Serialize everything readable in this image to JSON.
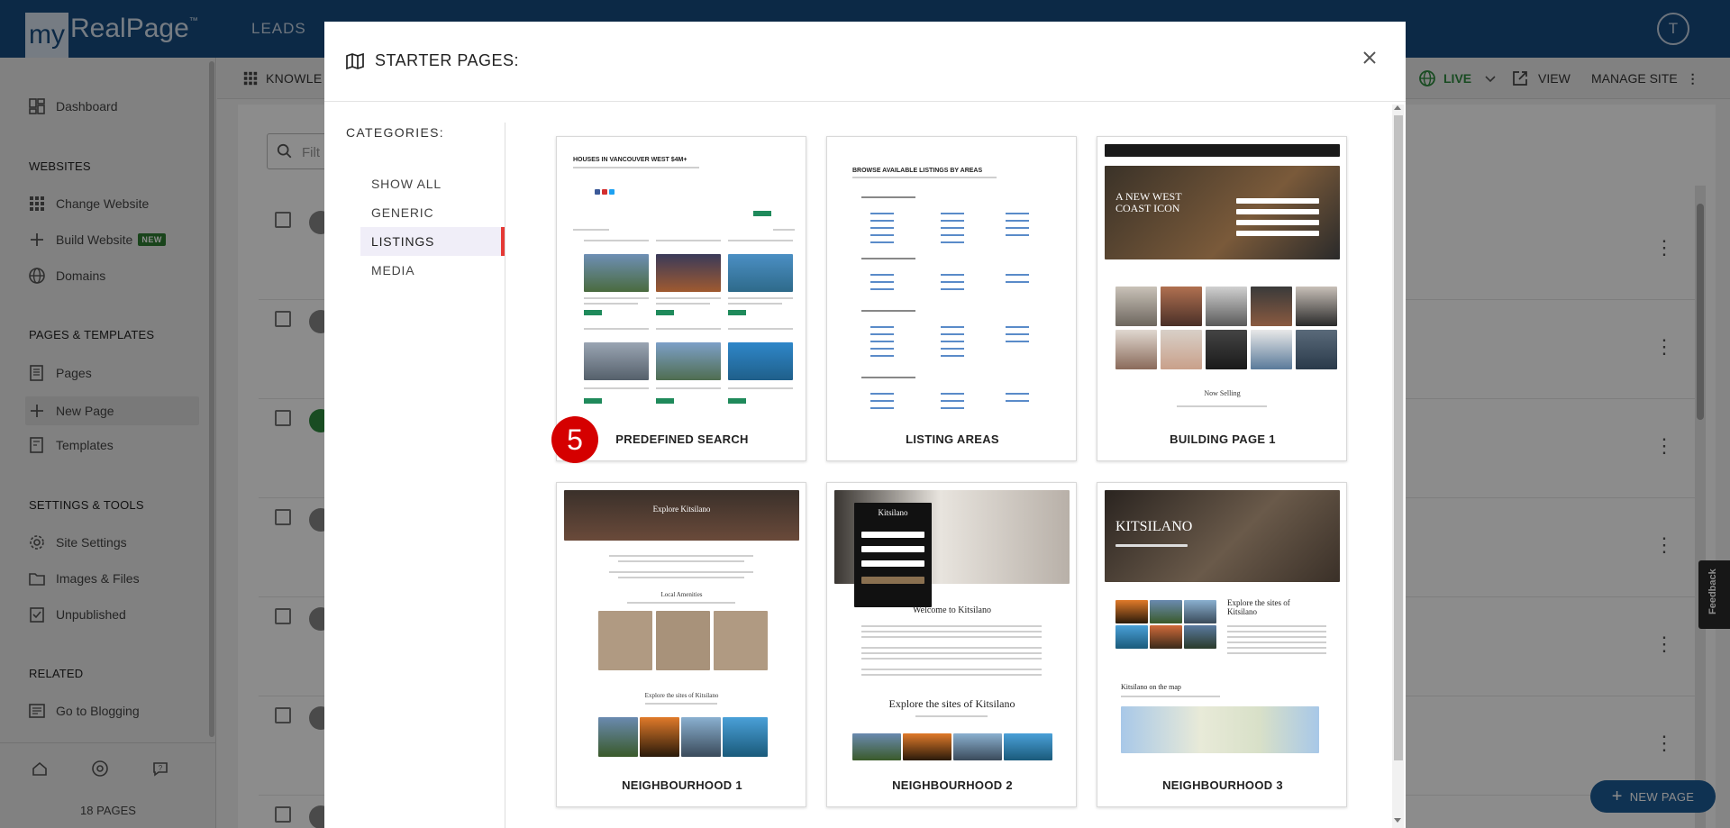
{
  "header": {
    "logo_prefix": "my",
    "logo_main": "RealPage",
    "logo_tm": "™",
    "nav_leads": "LEADS",
    "avatar_initial": "T"
  },
  "sidebar": {
    "dashboard": "Dashboard",
    "websites_heading": "WEBSITES",
    "change_website": "Change Website",
    "build_website": "Build Website",
    "build_badge": "NEW",
    "domains": "Domains",
    "pages_heading": "PAGES & TEMPLATES",
    "pages": "Pages",
    "new_page": "New Page",
    "templates": "Templates",
    "settings_heading": "SETTINGS & TOOLS",
    "site_settings": "Site Settings",
    "images_files": "Images & Files",
    "unpublished": "Unpublished",
    "related_heading": "RELATED",
    "go_blogging": "Go to Blogging",
    "pages_count": "18 PAGES"
  },
  "toolbar": {
    "knowledge_label": "KNOWLE",
    "live_label": "LIVE",
    "view_label": "VIEW",
    "manage_label": "MANAGE SITE",
    "filter_placeholder": "Filt"
  },
  "modal": {
    "title": "STARTER PAGES:",
    "categories_label": "CATEGORIES:",
    "categories": [
      "SHOW ALL",
      "GENERIC",
      "LISTINGS",
      "MEDIA"
    ],
    "active_category": "LISTINGS",
    "step_number": "5",
    "templates": [
      {
        "label": "PREDEFINED SEARCH"
      },
      {
        "label": "LISTING AREAS"
      },
      {
        "label": "BUILDING PAGE 1"
      },
      {
        "label": "NEIGHBOURHOOD 1"
      },
      {
        "label": "NEIGHBOURHOOD 2"
      },
      {
        "label": "NEIGHBOURHOOD 3"
      }
    ],
    "thumbs": {
      "predefined_title": "HOUSES IN VANCOUVER WEST $4M+",
      "areas_title": "BROWSE AVAILABLE LISTINGS BY AREAS",
      "building_title_1": "A NEW WEST",
      "building_title_2": "COAST ICON",
      "building_now_selling": "Now Selling",
      "n1_explore": "Explore Kitsilano",
      "n1_local": "Local Amenities",
      "n1_sites": "Explore the sites of Kitsilano",
      "n2_kits": "Kitsilano",
      "n2_welcome": "Welcome to Kitsilano",
      "n2_sites": "Explore the sites of Kitsilano",
      "n3_kits": "KITSILANO",
      "n3_sites_1": "Explore the sites of",
      "n3_sites_2": "Kitsilano",
      "n3_map": "Kitsilano on the map"
    }
  },
  "page": {
    "new_page_button": "NEW PAGE",
    "feedback": "Feedback"
  },
  "colors": {
    "brand_blue": "#164b80",
    "badge_red": "#d50000",
    "live_green": "#2e8b3e",
    "active_indicator": "#e53935"
  }
}
